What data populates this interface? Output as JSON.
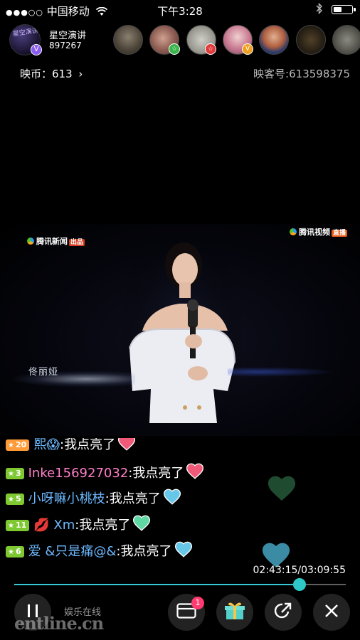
{
  "status_bar": {
    "signal": "●●●○○",
    "carrier": "中国移动",
    "wifi_icon": "wifi-icon",
    "time": "下午3:28",
    "bluetooth_icon": "bluetooth-icon",
    "battery_level_fraction": 0.45
  },
  "host": {
    "avatar_text": "星空演讲",
    "name": "星空演讲",
    "id": "897267",
    "verified": "V"
  },
  "viewers": [
    {
      "badge": "",
      "badge_color": ""
    },
    {
      "badge": "☆",
      "badge_color": "#39b54a"
    },
    {
      "badge": "☆",
      "badge_color": "#e03a3a"
    },
    {
      "badge": "V",
      "badge_color": "#f0a020"
    },
    {
      "badge": "",
      "badge_color": ""
    },
    {
      "badge": "",
      "badge_color": ""
    },
    {
      "badge": "",
      "badge_color": ""
    }
  ],
  "account": {
    "coins_label": "映币：613",
    "inke_id": "映客号:613598375"
  },
  "video": {
    "watermark_left": "腾讯新闻",
    "watermark_left_tag": "出品",
    "watermark_right": "腾讯视频",
    "watermark_right_tag": "直播",
    "caption": "佟丽娅"
  },
  "chat": [
    {
      "level": "20",
      "level_color": "#ff9b3a",
      "user": "熙😱",
      "user_color": "#6db9ff",
      "message": ":我点亮了",
      "heart_color": "#f05a78"
    },
    {
      "level": "3",
      "level_color": "#7ec832",
      "user": "Inke156927032",
      "user_color": "#ff7ec8",
      "message": ":我点亮了",
      "heart_color": "#f05a78"
    },
    {
      "level": "5",
      "level_color": "#7ec832",
      "user": "小呀嘛小桃枝",
      "user_color": "#6db9ff",
      "message": ":我点亮了",
      "heart_color": "#67c7e8"
    },
    {
      "level": "11",
      "level_color": "#7ec832",
      "user": "💋 Xm",
      "user_color": "#6db9ff",
      "message": ":我点亮了",
      "heart_color": "#5fd8a4"
    },
    {
      "level": "6",
      "level_color": "#7ec832",
      "user": "爱 &只是痛@&",
      "user_color": "#6db9ff",
      "message": ":我点亮了",
      "heart_color": "#67c7e8"
    }
  ],
  "playback": {
    "time": "02:43:15/03:09:55",
    "progress_fraction": 0.8597
  },
  "controls": {
    "pause_icon": "pause-icon",
    "message_icon": "message-icon",
    "message_badge": "1",
    "gift_icon": "gift-icon",
    "share_icon": "share-icon",
    "close_icon": "close-icon"
  },
  "branding": {
    "brand_text": "娱乐在线",
    "watermark": "entline.cn"
  }
}
